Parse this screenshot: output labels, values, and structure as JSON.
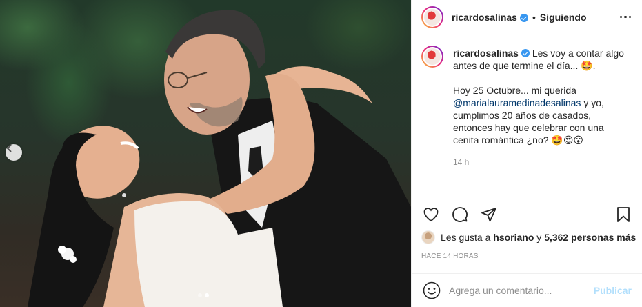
{
  "post": {
    "username": "ricardosalinas",
    "follow_status": "Siguiendo",
    "separator": "•",
    "caption": {
      "username": "ricardosalinas",
      "line1": "Les voy a contar algo antes de que termine el día... 🤩.",
      "p2_start": "Hoy 25 Octubre... mi querida",
      "mention": "@marialauramedinadesalinas",
      "p2_end": "y yo, cumplimos 20 años de casados, entonces hay que celebrar con una cenita romántica ¿no? 🤩😍😮"
    },
    "time": "14 h",
    "likes": {
      "prefix": "Les gusta a",
      "user": "hsoriano",
      "connector": "y",
      "count": "5,362 personas más"
    },
    "posted_ago": "HACE 14 HORAS",
    "comment": {
      "placeholder": "Agrega un comentario...",
      "publish": "Publicar"
    },
    "carousel": {
      "total": 2,
      "active_index": 2
    },
    "icons": [
      "verified-badge",
      "more-options-icon",
      "heart-icon",
      "comment-icon",
      "share-icon",
      "bookmark-icon",
      "emoji-icon",
      "chevron-left-icon"
    ],
    "colors": {
      "verified": "#3897f0",
      "mention": "#00376b",
      "publish_disabled": "#b2dffc",
      "muted": "#8e8e8e"
    }
  }
}
